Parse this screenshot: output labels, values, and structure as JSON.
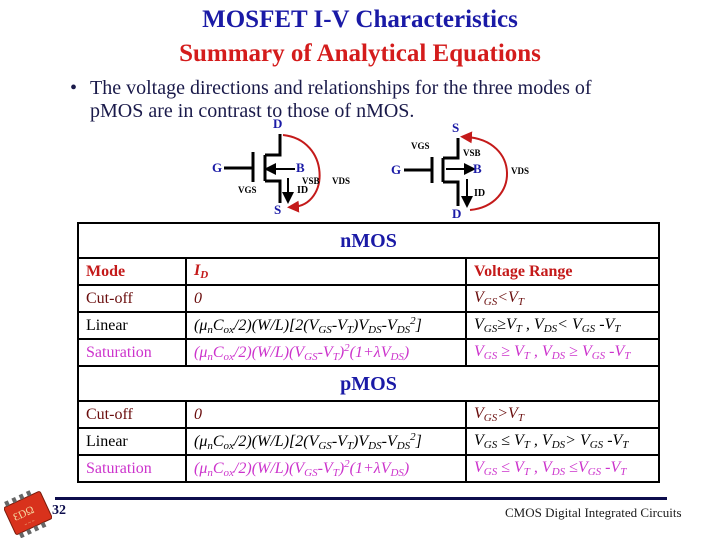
{
  "slide": {
    "title_line1": "MOSFET I-V Characteristics",
    "title_line2": "Summary of Analytical Equations",
    "bullet_symbol": "•",
    "bullet_line1": "The voltage directions and relationships for the three modes of",
    "bullet_line2": "pMOS are in contrast to those of nMOS.",
    "page_number": "32",
    "footer": "CMOS Digital Integrated Circuits"
  },
  "colors": {
    "title_blue": "#1a1aa6",
    "title_red": "#d41c1c",
    "cutoff": "#6a0d0d",
    "saturation": "#cc33cc",
    "arrow_red": "#c41a1a",
    "rule_navy": "#0d0d4d"
  },
  "nmos_symbol": {
    "drain": "D",
    "gate": "G",
    "bulk": "B",
    "source": "S",
    "vgs": "VGS",
    "vsb": "VSB",
    "vds": "VDS",
    "id": "ID"
  },
  "pmos_symbol": {
    "source": "S",
    "gate": "G",
    "bulk": "B",
    "drain": "D",
    "vgs": "VGS",
    "vsb": "VSB",
    "vds": "VDS",
    "id": "ID"
  },
  "table": {
    "header": {
      "mode": "Mode",
      "id_main": "I",
      "id_sub": "D",
      "range": "Voltage Range"
    },
    "nmos_label": "nMOS",
    "pmos_label": "pMOS",
    "nmos_rows": [
      {
        "mode": "Cut-off",
        "id": "0",
        "range": "VGS< VT"
      },
      {
        "mode": "Linear",
        "id": "(μnCox/2)(W/L)[2(VGS-VT)VDS-VDS²]",
        "range": "VGS≥VT , VDS< VGS -VT"
      },
      {
        "mode": "Saturation",
        "id": "(μnCox/2)(W/L)(VGS-VT)²(1+λVDS)",
        "range": "VGS ≥ VT , VDS ≥ VGS -VT"
      }
    ],
    "pmos_rows": [
      {
        "mode": "Cut-off",
        "id": "0",
        "range": "VGS> VT"
      },
      {
        "mode": "Linear",
        "id": "(μnCox/2)(W/L)[2(VGS-VT)VDS-VDS²]",
        "range": "VGS ≤ VT , VDS> VGS -VT"
      },
      {
        "mode": "Saturation",
        "id": "(μnCox/2)(W/L)(VGS-VT)²(1+λVDS)",
        "range": "VGS ≤ VT , VDS ≤VGS -VT"
      }
    ]
  }
}
